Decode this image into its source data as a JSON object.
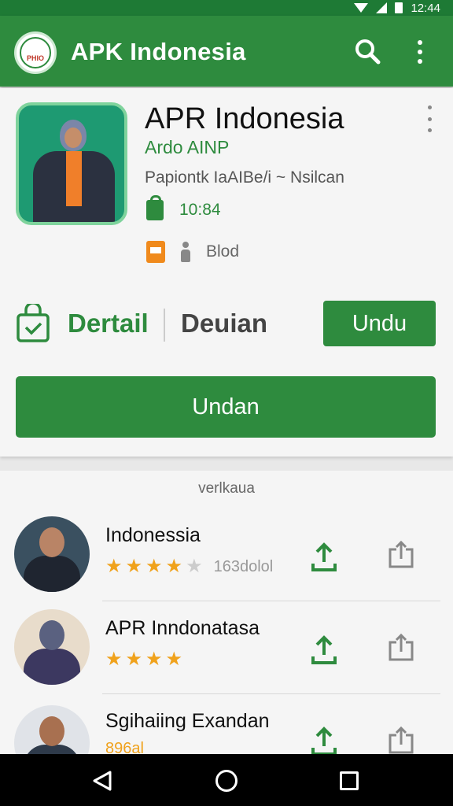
{
  "status_bar": {
    "time": "12:44"
  },
  "app_bar": {
    "logo_text": "PHIO",
    "title": "APK Indonesia",
    "colors": {
      "primary": "#2e8b3e",
      "accent_orange": "#f08a1c",
      "star": "#f0a21c"
    }
  },
  "app_card": {
    "name": "APR Indonesia",
    "developer": "Ardo AINP",
    "subtitle": "Papiontk IaAIBe/i ~ Nsilcan",
    "time": "10:84",
    "meta_label": "Blod",
    "detail_label": "Dertail",
    "deuian_label": "Deuian",
    "undu_button": "Undu",
    "undan_button": "Undan"
  },
  "list": {
    "section_label": "verlkaua",
    "items": [
      {
        "title": "Indonessia",
        "rating": 3.5,
        "count": "163dolol"
      },
      {
        "title": "APR Inndonatasa",
        "rating": 3.5,
        "count": ""
      },
      {
        "title": "Sgihaiing Exandan",
        "rating": 0,
        "count": "896al"
      }
    ]
  },
  "icons": [
    "search-icon",
    "more-vert-icon",
    "lock-icon",
    "calendar-icon",
    "person-icon",
    "shopping-bag-icon",
    "download-icon",
    "share-icon",
    "back-icon",
    "home-icon",
    "recent-apps-icon"
  ]
}
